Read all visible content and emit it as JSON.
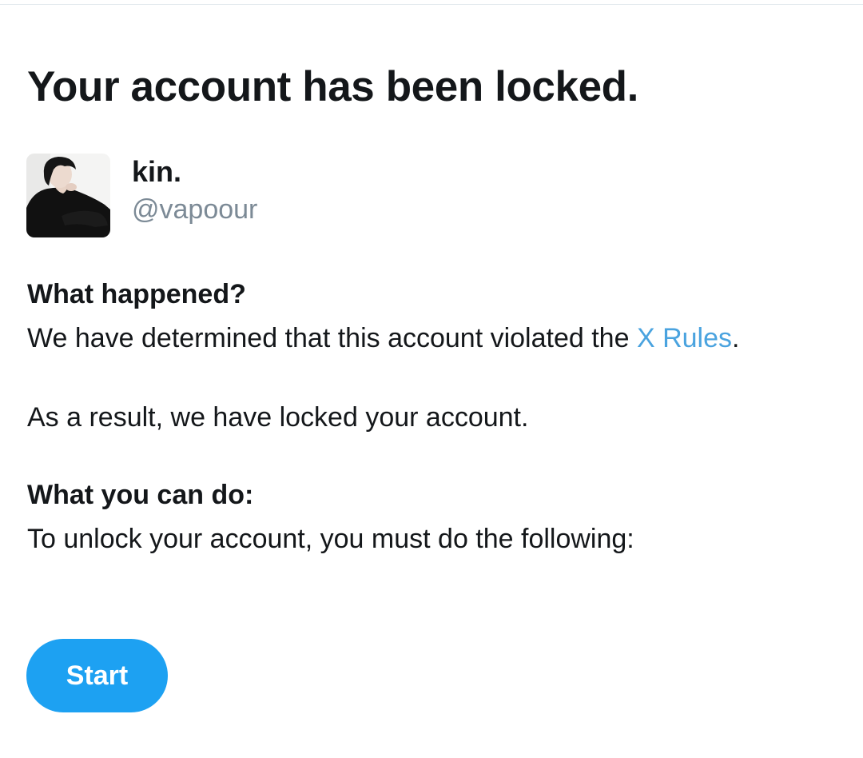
{
  "title": "Your account has been locked.",
  "account": {
    "display_name": "kin.",
    "handle": "@vapoour"
  },
  "what_happened": {
    "heading": "What happened?",
    "text_before_link": "We have determined that this account violated the ",
    "link_text": "X Rules",
    "text_after_link": ".",
    "result": "As a result, we have locked your account."
  },
  "what_you_can_do": {
    "heading": "What you can do:",
    "text": "To unlock your account, you must do the following:"
  },
  "start_button_label": "Start",
  "colors": {
    "accent": "#1da1f2",
    "link": "#4aa3df",
    "handle": "#7c8a96",
    "text": "#14171a"
  }
}
